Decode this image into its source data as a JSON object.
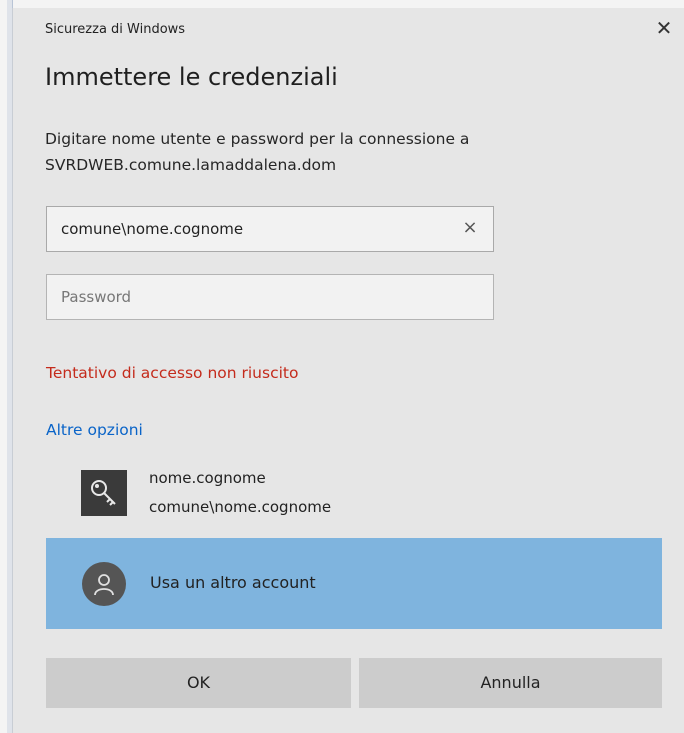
{
  "window": {
    "title": "Sicurezza di Windows",
    "close_icon": "close-icon"
  },
  "heading": "Immettere le credenziali",
  "description": {
    "line1": "Digitare nome utente e password per la connessione a",
    "line2": "SVRDWEB.comune.lamaddalena.dom"
  },
  "username_field": {
    "value": "comune\\nome.cognome",
    "clear_glyph": "×"
  },
  "password_field": {
    "placeholder": "Password"
  },
  "error": "Tentativo di accesso non riuscito",
  "more_options": "Altre opzioni",
  "saved_account": {
    "name": "nome.cognome",
    "domain_user": "comune\\nome.cognome",
    "icon": "key-icon"
  },
  "other_account": {
    "label": "Usa un altro account",
    "icon": "person-icon",
    "highlight_color": "#7fb4de"
  },
  "buttons": {
    "ok": "OK",
    "cancel": "Annulla"
  },
  "colors": {
    "error": "#c42b1c",
    "link": "#0a64c8"
  }
}
